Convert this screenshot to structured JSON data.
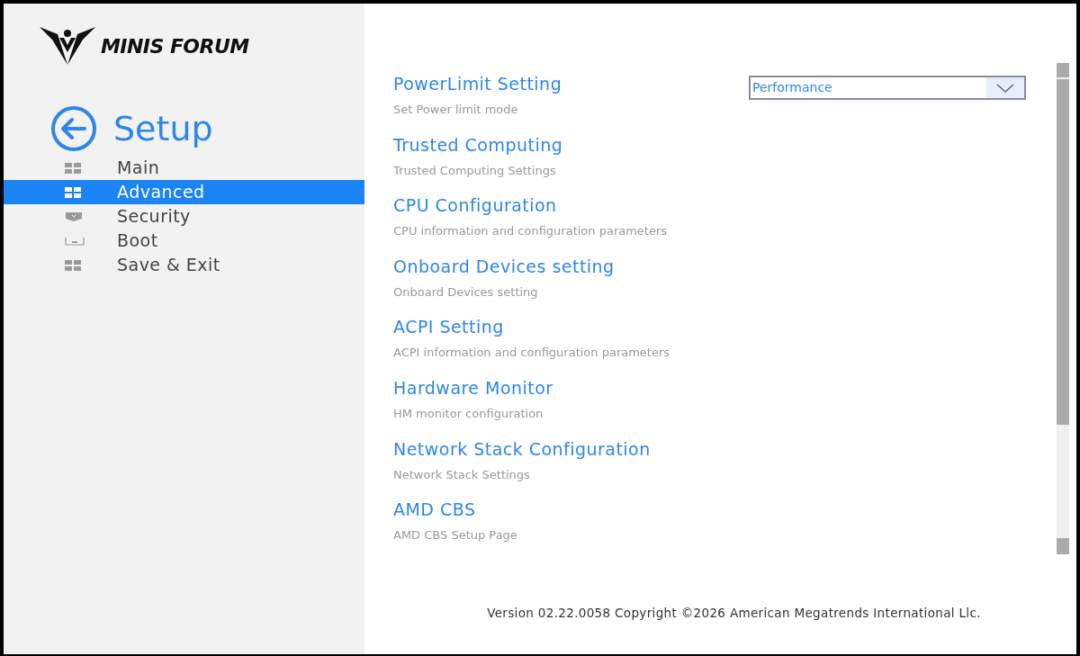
{
  "logo": {
    "text": "MINIS FORUM"
  },
  "sidebar": {
    "title": "Setup",
    "items": [
      {
        "label": "Main",
        "selected": false,
        "kind": "grid"
      },
      {
        "label": "Advanced",
        "selected": true,
        "kind": "grid"
      },
      {
        "label": "Security",
        "selected": false,
        "kind": "shield"
      },
      {
        "label": "Boot",
        "selected": false,
        "kind": "tray"
      },
      {
        "label": "Save & Exit",
        "selected": false,
        "kind": "grid"
      }
    ]
  },
  "settings": [
    {
      "title": "PowerLimit Setting",
      "description": "Set Power limit mode",
      "dropdown": {
        "value": "Performance"
      }
    },
    {
      "title": "Trusted Computing",
      "description": "Trusted Computing Settings"
    },
    {
      "title": "CPU Configuration",
      "description": "CPU information and configuration parameters"
    },
    {
      "title": "Onboard Devices setting",
      "description": "Onboard Devices setting"
    },
    {
      "title": "ACPI Setting",
      "description": "ACPI information and configuration parameters"
    },
    {
      "title": "Hardware Monitor",
      "description": "HM monitor configuration"
    },
    {
      "title": "Network Stack Configuration",
      "description": "Network Stack Settings"
    },
    {
      "title": "AMD CBS",
      "description": "AMD CBS Setup Page"
    }
  ],
  "footer": "Version 02.22.0058 Copyright ©2026 American Megatrends International Llc."
}
